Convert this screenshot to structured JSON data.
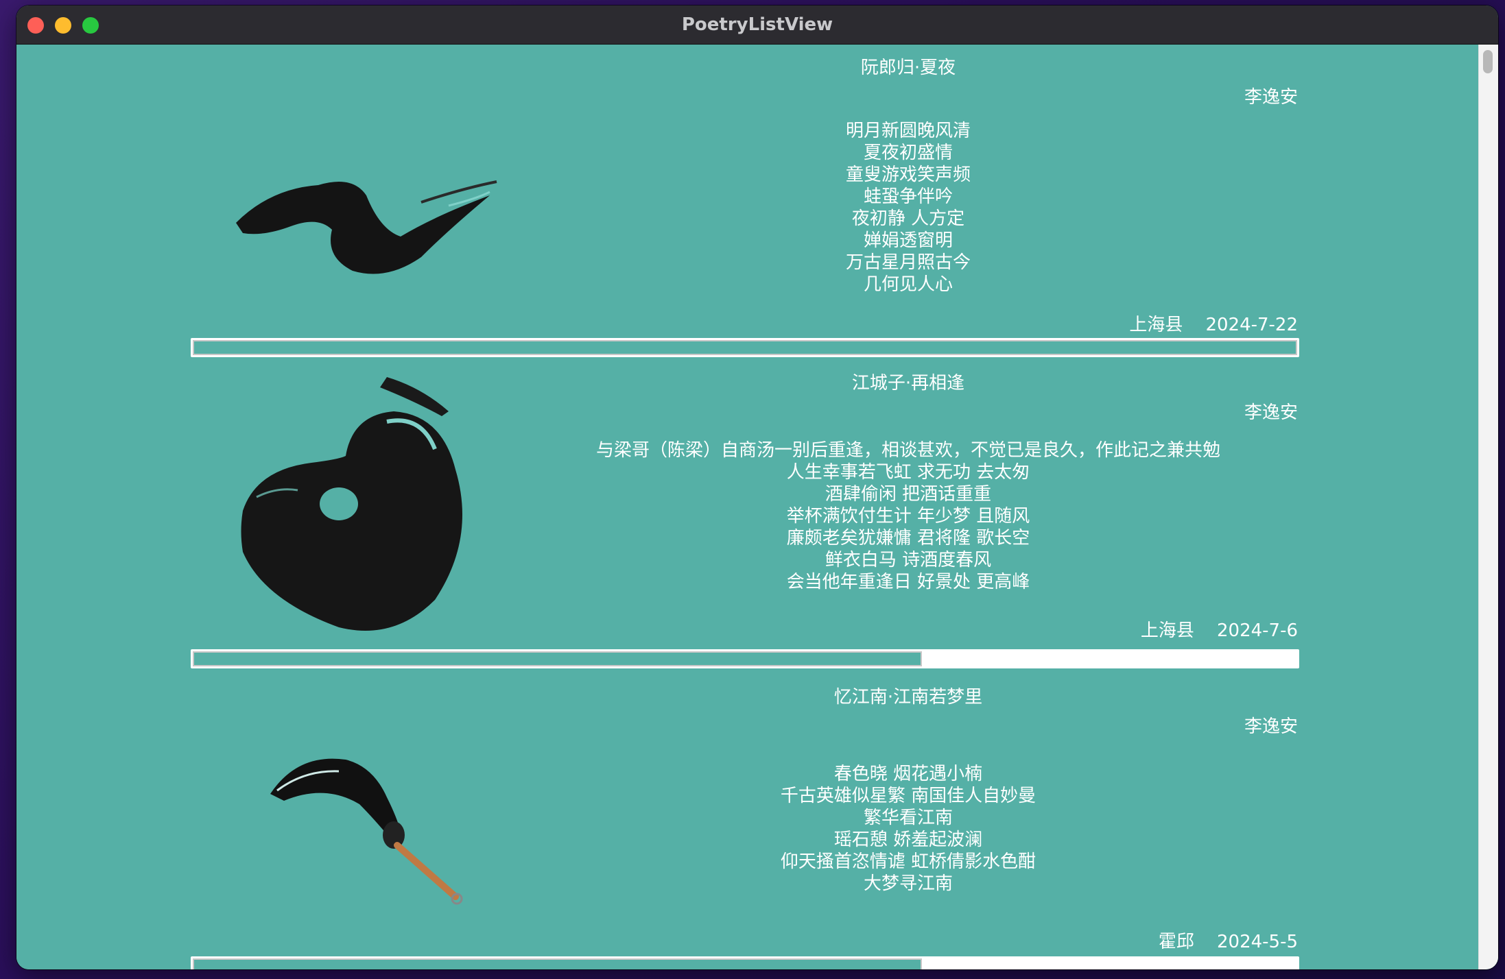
{
  "window": {
    "title": "PoetryListView"
  },
  "poems": [
    {
      "title": "阮郎归·夏夜",
      "author": "李逸安",
      "lines": [
        "明月新圆晚风清",
        "夏夜初盛情",
        "童叟游戏笑声频",
        "蛙蛩争伴吟",
        "夜初静 人方定",
        "婵娟透窗明",
        "万古星月照古今",
        "几何见人心"
      ],
      "place": "上海县",
      "date": "2024-7-22",
      "progress": 1.0
    },
    {
      "title": "江城子·再相逢",
      "author": "李逸安",
      "lines": [
        "与梁哥（陈梁）自商汤一别后重逢，相谈甚欢，不觉已是良久，作此记之兼共勉",
        "人生幸事若飞虹 求无功 去太匆",
        "酒肆偷闲 把酒话重重",
        "举杯满饮付生计 年少梦 且随风",
        "廉颇老矣犹嫌慵 君将隆 歌长空",
        "鲜衣白马 诗酒度春风",
        "会当他年重逢日 好景处 更高峰"
      ],
      "place": "上海县",
      "date": "2024-7-6",
      "progress": 0.66
    },
    {
      "title": "忆江南·江南若梦里",
      "author": "李逸安",
      "lines": [
        "春色晓 烟花遇小楠",
        "千古英雄似星繁 南国佳人自妙曼",
        "繁华看江南",
        "瑶石憩 娇羞起波澜",
        "仰天搔首恣情谑 虹桥倩影水色酣",
        "大梦寻江南"
      ],
      "place": "霍邱",
      "date": "2024-5-5",
      "progress": 0.66
    }
  ]
}
